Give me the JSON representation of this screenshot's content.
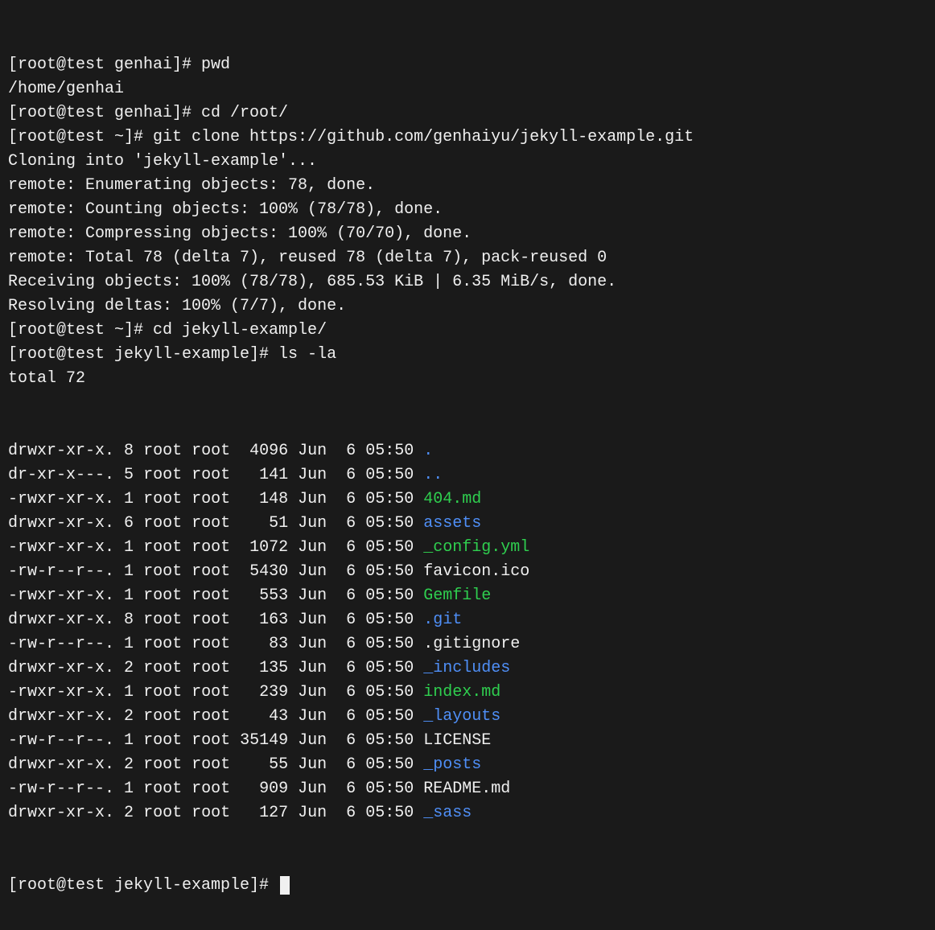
{
  "lines": [
    {
      "spans": [
        {
          "t": "[root@test genhai]# pwd",
          "c": "plain"
        }
      ]
    },
    {
      "spans": [
        {
          "t": "/home/genhai",
          "c": "plain"
        }
      ]
    },
    {
      "spans": [
        {
          "t": "[root@test genhai]# cd /root/",
          "c": "plain"
        }
      ]
    },
    {
      "spans": [
        {
          "t": "[root@test ~]# git clone https://github.com/genhaiyu/jekyll-example.git",
          "c": "plain"
        }
      ]
    },
    {
      "spans": [
        {
          "t": "Cloning into 'jekyll-example'...",
          "c": "plain"
        }
      ]
    },
    {
      "spans": [
        {
          "t": "remote: Enumerating objects: 78, done.",
          "c": "plain"
        }
      ]
    },
    {
      "spans": [
        {
          "t": "remote: Counting objects: 100% (78/78), done.",
          "c": "plain"
        }
      ]
    },
    {
      "spans": [
        {
          "t": "remote: Compressing objects: 100% (70/70), done.",
          "c": "plain"
        }
      ]
    },
    {
      "spans": [
        {
          "t": "remote: Total 78 (delta 7), reused 78 (delta 7), pack-reused 0",
          "c": "plain"
        }
      ]
    },
    {
      "spans": [
        {
          "t": "Receiving objects: 100% (78/78), 685.53 KiB | 6.35 MiB/s, done.",
          "c": "plain"
        }
      ]
    },
    {
      "spans": [
        {
          "t": "Resolving deltas: 100% (7/7), done.",
          "c": "plain"
        }
      ]
    },
    {
      "spans": [
        {
          "t": "[root@test ~]# cd jekyll-example/",
          "c": "plain"
        }
      ]
    },
    {
      "spans": [
        {
          "t": "[root@test jekyll-example]# ls -la",
          "c": "plain"
        }
      ]
    },
    {
      "spans": [
        {
          "t": "total 72",
          "c": "plain"
        }
      ]
    }
  ],
  "ls": [
    {
      "perm": "drwxr-xr-x.",
      "links": "8",
      "owner": "root",
      "group": "root",
      "size": "4096",
      "mon": "Jun",
      "day": "6",
      "time": "05:50",
      "name": ".",
      "c": "dir"
    },
    {
      "perm": "dr-xr-x---.",
      "links": "5",
      "owner": "root",
      "group": "root",
      "size": "141",
      "mon": "Jun",
      "day": "6",
      "time": "05:50",
      "name": "..",
      "c": "dir"
    },
    {
      "perm": "-rwxr-xr-x.",
      "links": "1",
      "owner": "root",
      "group": "root",
      "size": "148",
      "mon": "Jun",
      "day": "6",
      "time": "05:50",
      "name": "404.md",
      "c": "exec"
    },
    {
      "perm": "drwxr-xr-x.",
      "links": "6",
      "owner": "root",
      "group": "root",
      "size": "51",
      "mon": "Jun",
      "day": "6",
      "time": "05:50",
      "name": "assets",
      "c": "dir"
    },
    {
      "perm": "-rwxr-xr-x.",
      "links": "1",
      "owner": "root",
      "group": "root",
      "size": "1072",
      "mon": "Jun",
      "day": "6",
      "time": "05:50",
      "name": "_config.yml",
      "c": "exec"
    },
    {
      "perm": "-rw-r--r--.",
      "links": "1",
      "owner": "root",
      "group": "root",
      "size": "5430",
      "mon": "Jun",
      "day": "6",
      "time": "05:50",
      "name": "favicon.ico",
      "c": "plain"
    },
    {
      "perm": "-rwxr-xr-x.",
      "links": "1",
      "owner": "root",
      "group": "root",
      "size": "553",
      "mon": "Jun",
      "day": "6",
      "time": "05:50",
      "name": "Gemfile",
      "c": "exec"
    },
    {
      "perm": "drwxr-xr-x.",
      "links": "8",
      "owner": "root",
      "group": "root",
      "size": "163",
      "mon": "Jun",
      "day": "6",
      "time": "05:50",
      "name": ".git",
      "c": "dir"
    },
    {
      "perm": "-rw-r--r--.",
      "links": "1",
      "owner": "root",
      "group": "root",
      "size": "83",
      "mon": "Jun",
      "day": "6",
      "time": "05:50",
      "name": ".gitignore",
      "c": "plain"
    },
    {
      "perm": "drwxr-xr-x.",
      "links": "2",
      "owner": "root",
      "group": "root",
      "size": "135",
      "mon": "Jun",
      "day": "6",
      "time": "05:50",
      "name": "_includes",
      "c": "dir"
    },
    {
      "perm": "-rwxr-xr-x.",
      "links": "1",
      "owner": "root",
      "group": "root",
      "size": "239",
      "mon": "Jun",
      "day": "6",
      "time": "05:50",
      "name": "index.md",
      "c": "exec"
    },
    {
      "perm": "drwxr-xr-x.",
      "links": "2",
      "owner": "root",
      "group": "root",
      "size": "43",
      "mon": "Jun",
      "day": "6",
      "time": "05:50",
      "name": "_layouts",
      "c": "dir"
    },
    {
      "perm": "-rw-r--r--.",
      "links": "1",
      "owner": "root",
      "group": "root",
      "size": "35149",
      "mon": "Jun",
      "day": "6",
      "time": "05:50",
      "name": "LICENSE",
      "c": "plain"
    },
    {
      "perm": "drwxr-xr-x.",
      "links": "2",
      "owner": "root",
      "group": "root",
      "size": "55",
      "mon": "Jun",
      "day": "6",
      "time": "05:50",
      "name": "_posts",
      "c": "dir"
    },
    {
      "perm": "-rw-r--r--.",
      "links": "1",
      "owner": "root",
      "group": "root",
      "size": "909",
      "mon": "Jun",
      "day": "6",
      "time": "05:50",
      "name": "README.md",
      "c": "plain"
    },
    {
      "perm": "drwxr-xr-x.",
      "links": "2",
      "owner": "root",
      "group": "root",
      "size": "127",
      "mon": "Jun",
      "day": "6",
      "time": "05:50",
      "name": "_sass",
      "c": "dir"
    }
  ],
  "finalPrompt": "[root@test jekyll-example]# "
}
